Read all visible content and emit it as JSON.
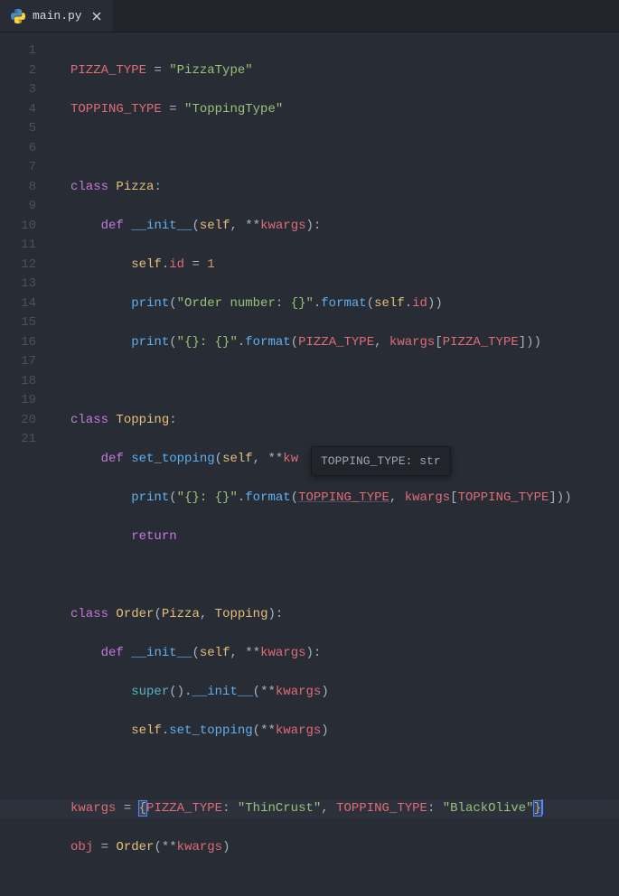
{
  "tab": {
    "filename": "main.py",
    "icon": "python-icon"
  },
  "hint": {
    "text": "TOPPING_TYPE: str"
  },
  "gutter": [
    "1",
    "2",
    "3",
    "4",
    "5",
    "6",
    "7",
    "8",
    "9",
    "10",
    "11",
    "12",
    "13",
    "14",
    "15",
    "16",
    "17",
    "18",
    "19",
    "20",
    "21"
  ],
  "code": {
    "l1": {
      "a": "PIZZA_TYPE",
      "b": "=",
      "c": "\"PizzaType\""
    },
    "l2": {
      "a": "TOPPING_TYPE",
      "b": "=",
      "c": "\"ToppingType\""
    },
    "l4": {
      "a": "class",
      "b": "Pizza",
      "c": ":"
    },
    "l5": {
      "a": "def",
      "b": "__init__",
      "c": "(",
      "d": "self",
      "e": ",",
      "f": "**",
      "g": "kwargs",
      "h": ")",
      "i": ":"
    },
    "l6": {
      "a": "self",
      "b": ".",
      "c": "id",
      "d": "=",
      "e": "1"
    },
    "l7": {
      "a": "print",
      "b": "(",
      "c": "\"Order number: {}\"",
      "d": ".",
      "e": "format",
      "f": "(",
      "g": "self",
      "h": ".",
      "i": "id",
      "j": ")",
      "k": ")"
    },
    "l8": {
      "a": "print",
      "b": "(",
      "c": "\"{}: {}\"",
      "d": ".",
      "e": "format",
      "f": "(",
      "g": "PIZZA_TYPE",
      "h": ",",
      "i": "kwargs",
      "j": "[",
      "k": "PIZZA_TYPE",
      "l": "]",
      "m": ")",
      "n": ")"
    },
    "l10": {
      "a": "class",
      "b": "Topping",
      "c": ":"
    },
    "l11": {
      "a": "def",
      "b": "set_topping",
      "c": "(",
      "d": "self",
      "e": ",",
      "f": "**",
      "g": "kw"
    },
    "l12": {
      "a": "print",
      "b": "(",
      "c": "\"{}: {}\"",
      "d": ".",
      "e": "format",
      "f": "(",
      "g": "TOPPING_TYPE",
      "h": ",",
      "i": "kwargs",
      "j": "[",
      "k": "TOPPING_TYPE",
      "l": "]",
      "m": ")",
      "n": ")"
    },
    "l13": {
      "a": "return"
    },
    "l15": {
      "a": "class",
      "b": "Order",
      "c": "(",
      "d": "Pizza",
      "e": ",",
      "f": "Topping",
      "g": ")",
      "h": ":"
    },
    "l16": {
      "a": "def",
      "b": "__init__",
      "c": "(",
      "d": "self",
      "e": ",",
      "f": "**",
      "g": "kwargs",
      "h": ")",
      "i": ":"
    },
    "l17": {
      "a": "super",
      "b": "(",
      "c": ")",
      "d": ".",
      "e": "__init__",
      "f": "(",
      "g": "**",
      "h": "kwargs",
      "i": ")"
    },
    "l18": {
      "a": "self",
      "b": ".",
      "c": "set_topping",
      "d": "(",
      "e": "**",
      "f": "kwargs",
      "g": ")"
    },
    "l20": {
      "a": "kwargs",
      "b": "=",
      "c": "{",
      "d": "PIZZA_TYPE",
      "e": ":",
      "f": "\"ThinCrust\"",
      "g": ",",
      "h": "TOPPING_TYPE",
      "i": ":",
      "j": "\"BlackOlive\"",
      "k": "}"
    },
    "l21": {
      "a": "obj",
      "b": "=",
      "c": "Order",
      "d": "(",
      "e": "**",
      "f": "kwargs",
      "g": ")"
    }
  }
}
